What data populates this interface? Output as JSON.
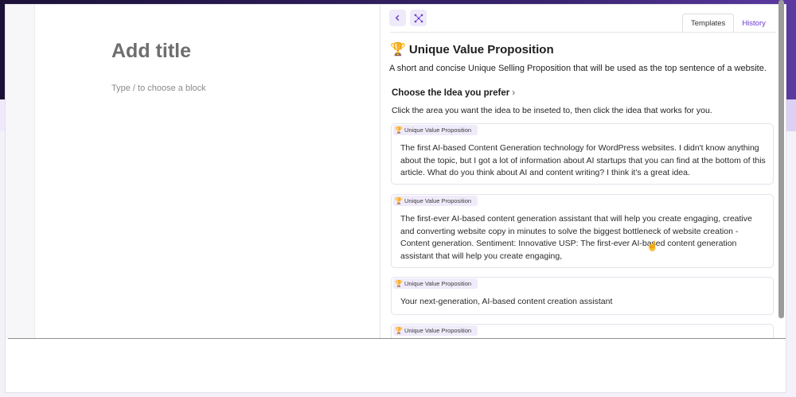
{
  "editor": {
    "title_placeholder": "Add title",
    "block_placeholder": "Type / to choose a block"
  },
  "panel": {
    "tabs": [
      {
        "label": "Templates",
        "active": true
      },
      {
        "label": "History",
        "active": false
      }
    ],
    "heading": "Unique Value Proposition",
    "heading_icon": "trophy-icon",
    "subtitle": "A short and concise Unique Selling Proposition that will be used as the top sentence of a website.",
    "choose_label": "Choose the Idea you prefer",
    "instructions": "Click the area you want the idea to be inseted to, then click the idea that works for you.",
    "cards": [
      {
        "tag": "Unique Value Proposition",
        "text": "The first AI-based Content Generation technology for WordPress websites. I didn't know anything about the topic, but I got a lot of information about AI startups that you can find at the bottom of this article. What do you think about AI and content writing? I think it's a great idea."
      },
      {
        "tag": "Unique Value Proposition",
        "text": "The first-ever AI-based content generation assistant that will help you create engaging, creative and converting website copy in minutes to solve the biggest bottleneck of website creation - Content generation. Sentiment: Innovative USP: The first-ever AI-based content generation assistant that will help you create engaging,"
      },
      {
        "tag": "Unique Value Proposition",
        "text": "Your next-generation, AI-based content creation assistant"
      },
      {
        "tag": "Unique Value Proposition",
        "text": ""
      }
    ]
  },
  "colors": {
    "accent": "#6a3ad0",
    "tag_bg": "#f0ebfa",
    "header_bg": "#2a1a52"
  }
}
